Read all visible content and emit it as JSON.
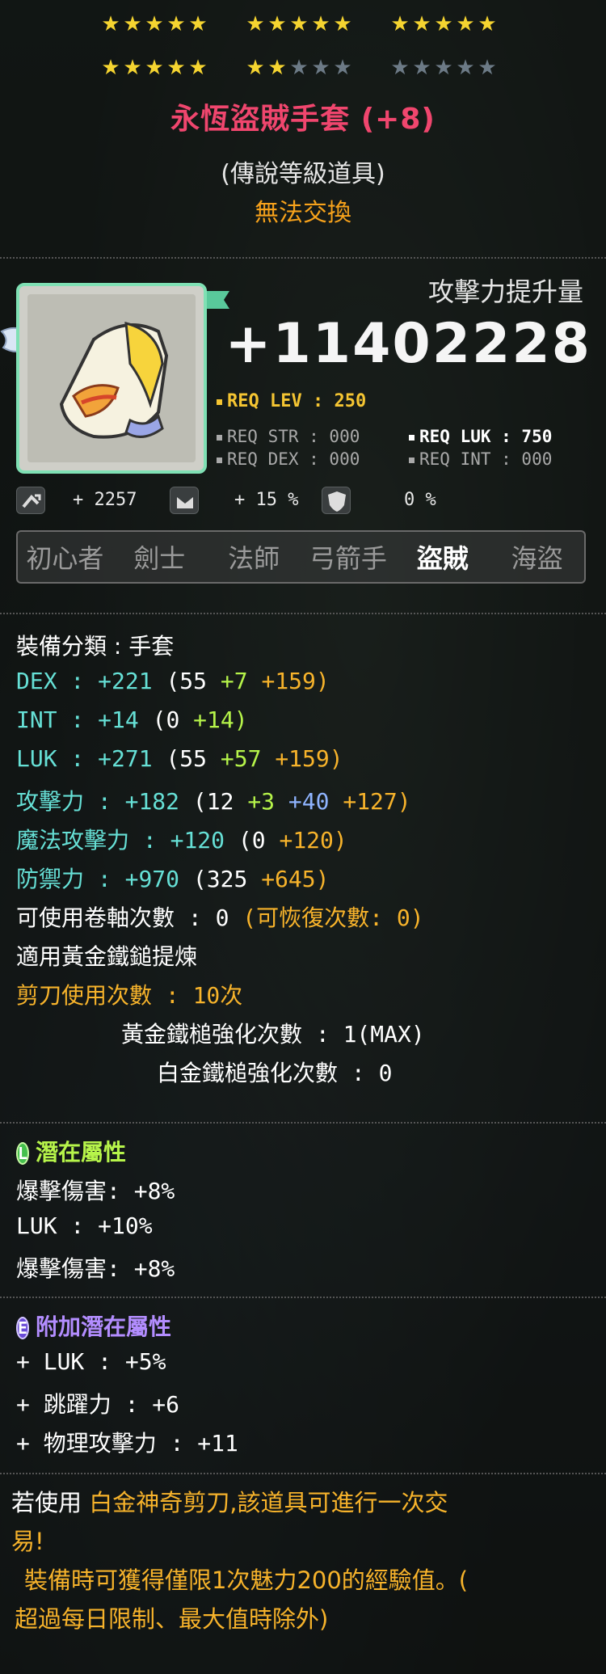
{
  "stars": {
    "rows": [
      {
        "groups": [
          5,
          5,
          5
        ],
        "lit": 15
      },
      {
        "groups": [
          5,
          5,
          5
        ],
        "lit": 7
      }
    ]
  },
  "item": {
    "name": "永恆盜賊手套 (+8)",
    "grade": "(傳說等級道具)",
    "trade": "無法交換",
    "icon": "glove-icon"
  },
  "attack_boost": {
    "label": "攻擊力提升量",
    "value": "+11402228"
  },
  "requirements": {
    "level": "REQ LEV : 250",
    "str": "REQ STR : 000",
    "dex": "REQ DEX : 000",
    "luk": "REQ LUK : 750",
    "int": "REQ INT : 000"
  },
  "mini_stats": {
    "growth": "+ 2257",
    "upgrade": "+ 15 %",
    "shield": "0 %"
  },
  "jobs": [
    "初心者",
    "劍士",
    "法師",
    "弓箭手",
    "盜賊",
    "海盜"
  ],
  "active_job": "盜賊",
  "stats": {
    "category": "裝備分類 : 手套",
    "dex": {
      "label": "DEX",
      "total": "+221",
      "base": "(55",
      "star": "+7",
      "flame": "+159)"
    },
    "int": {
      "label": "INT",
      "total": "+14",
      "base": "(0",
      "star": "+14)"
    },
    "luk": {
      "label": "LUK",
      "total": "+271",
      "base": "(55",
      "star": "+57",
      "flame": "+159)"
    },
    "atk": {
      "label": "攻擊力",
      "total": "+182",
      "base": "(12",
      "a": "+3",
      "b": "+40",
      "c": "+127)"
    },
    "matk": {
      "label": "魔法攻擊力",
      "total": "+120",
      "base": "(0",
      "a": "+120)"
    },
    "def": {
      "label": "防禦力",
      "total": "+970",
      "base": "(325",
      "a": "+645)"
    },
    "scrolls": "可使用卷軸次數 : 0",
    "scrolls_restore": "(可恢復次數: 0)",
    "hammer_applied": "適用黃金鐵鎚提煉",
    "scissors": "剪刀使用次數 : 10次",
    "golden_hammer": "黃金鐵槌強化次數 : 1(MAX)",
    "platinum_hammer": "白金鐵槌強化次數 : 0"
  },
  "potential": {
    "title": "潛在屬性",
    "badge": "L",
    "lines": [
      "爆擊傷害: +8%",
      "LUK : +10%",
      "爆擊傷害: +8%"
    ]
  },
  "additional": {
    "title": "附加潛在屬性",
    "badge": "E",
    "lines": [
      "+ LUK : +5%",
      "+ 跳躍力 : +6",
      "+ 物理攻擊力 : +11"
    ]
  },
  "footer": {
    "line1_a": "若使用",
    "line1_b": "白金神奇剪刀,該道具可進行一次交",
    "line2": "易!",
    "line3": "裝備時可獲得僅限1次魅力200的經驗值。(",
    "line4": "超過每日限制、最大值時除外)"
  }
}
